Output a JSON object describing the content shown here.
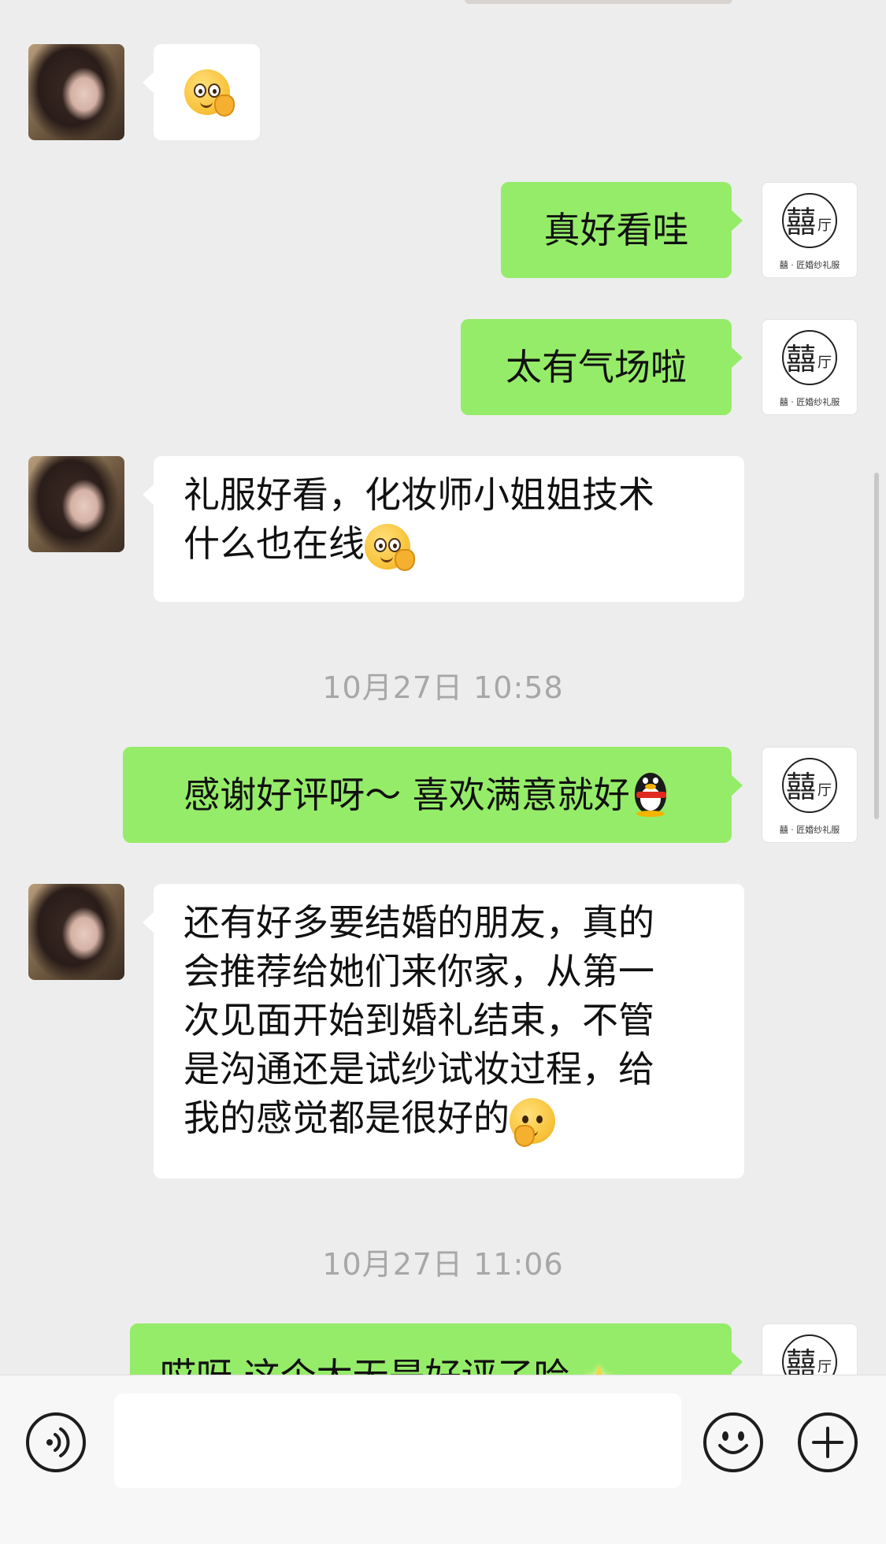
{
  "messages": [
    {
      "side": "left",
      "type": "emoji",
      "emoji": "peek-emoji"
    },
    {
      "side": "right",
      "text": "真好看哇"
    },
    {
      "side": "right",
      "text": "太有气场啦"
    },
    {
      "side": "left",
      "lines": [
        "礼服好看，化妆师小姐姐技术",
        "什么也在线"
      ],
      "trailing_emoji": "peek-emoji"
    },
    {
      "type": "timestamp",
      "text": "10月27日 10:58"
    },
    {
      "side": "right",
      "text": "感谢好评呀～ 喜欢满意就好",
      "trailing_emoji": "penguin-emoji"
    },
    {
      "side": "left",
      "lines": [
        "还有好多要结婚的朋友，真的",
        "会推荐给她们来你家，从第一",
        "次见面开始到婚礼结束，不管",
        "是沟通还是试纱试妆过程，给",
        "我的感觉都是很好的"
      ],
      "trailing_emoji": "thinking-emoji"
    },
    {
      "type": "timestamp",
      "text": "10月27日 11:06"
    },
    {
      "side": "right",
      "text": "哎呀 这个太无是好评了哈",
      "trailing_emoji": "sparkle-star-emoji"
    }
  ],
  "shop_avatar": {
    "logo_text": "囍",
    "tagline": "囍 · 匠婚纱礼服",
    "side_char": "厅"
  },
  "colors": {
    "background": "#ededed",
    "bubble_sent": "#95ec69",
    "bubble_received": "#ffffff",
    "timestamp": "#a7a7a7"
  },
  "input_bar": {
    "voice_icon": "voice-icon",
    "emoji_icon": "smiley-icon",
    "more_icon": "plus-icon",
    "text_value": ""
  }
}
